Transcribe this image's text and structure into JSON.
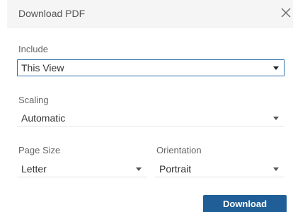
{
  "dialog": {
    "title": "Download PDF",
    "close_icon": "close-icon"
  },
  "include": {
    "label": "Include",
    "value": "This View"
  },
  "scaling": {
    "label": "Scaling",
    "value": "Automatic"
  },
  "page_size": {
    "label": "Page Size",
    "value": "Letter"
  },
  "orientation": {
    "label": "Orientation",
    "value": "Portrait"
  },
  "actions": {
    "download_label": "Download"
  },
  "colors": {
    "header_bg": "#f5f5f5",
    "focus_border": "#2e6fae",
    "primary_button": "#1f5e96"
  }
}
